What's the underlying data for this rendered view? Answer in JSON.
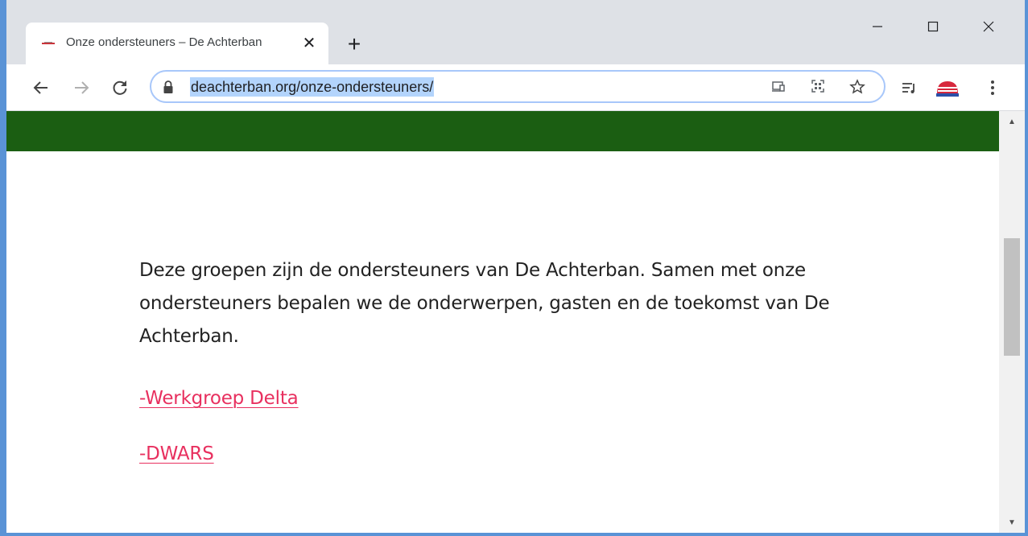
{
  "browser": {
    "tab": {
      "title": "Onze ondersteuners – De Achterban",
      "close_label": "✕"
    },
    "new_tab_label": "+",
    "window_controls": {
      "minimize": "—",
      "maximize": "☐",
      "close": "✕"
    },
    "nav": {
      "back": "←",
      "forward": "→",
      "reload": "C"
    },
    "omnibox": {
      "url": "deachterban.org/onze-ondersteuners/"
    },
    "icons": [
      "cast-icon",
      "qr-code-icon",
      "star-icon",
      "reading-list-icon",
      "profile-avatar-icon",
      "menu-icon"
    ]
  },
  "page": {
    "header_color": "#1b5e12",
    "intro": "Deze groepen zijn de ondersteuners van De Achterban. Samen met onze ondersteuners bepalen we de onderwerpen, gasten en de toekomst van De Achterban.",
    "links": [
      {
        "label": "-Werkgroep Delta"
      },
      {
        "label": "-DWARS"
      }
    ],
    "link_color": "#e8305f"
  }
}
